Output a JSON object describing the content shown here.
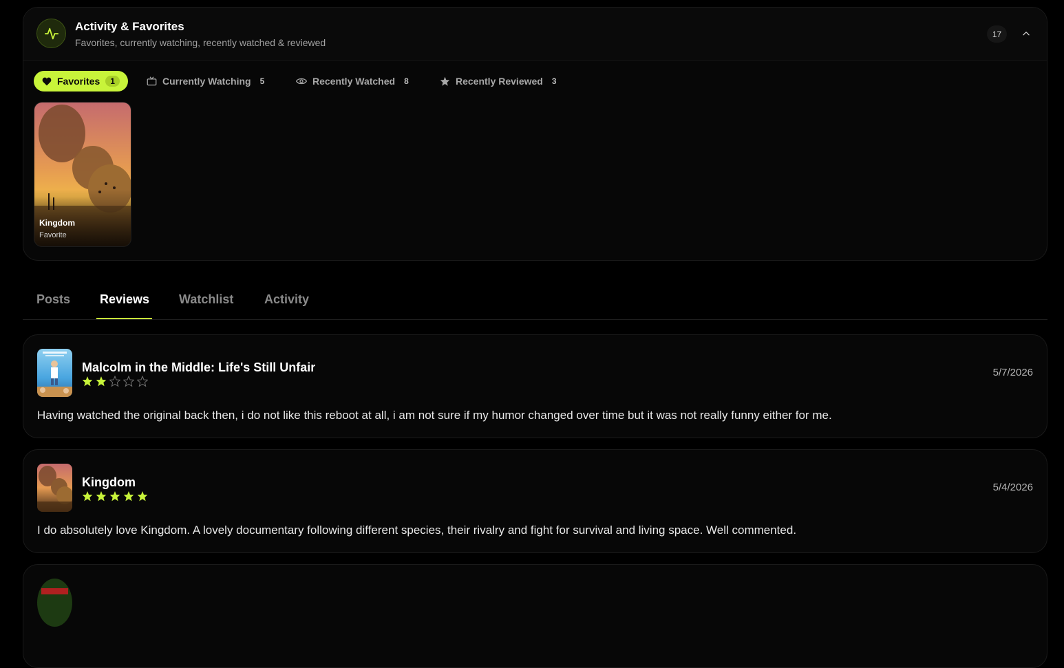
{
  "activity": {
    "title": "Activity & Favorites",
    "subtitle": "Favorites, currently watching, recently watched & reviewed",
    "total_count": "17",
    "accent_color": "#c8f43a",
    "chips": [
      {
        "label": "Favorites",
        "count": "1",
        "icon": "heart-icon",
        "active": true
      },
      {
        "label": "Currently Watching",
        "count": "5",
        "icon": "tv-icon",
        "active": false
      },
      {
        "label": "Recently Watched",
        "count": "8",
        "icon": "eye-icon",
        "active": false
      },
      {
        "label": "Recently Reviewed",
        "count": "3",
        "icon": "star-icon",
        "active": false
      }
    ],
    "favorites": [
      {
        "title": "Kingdom",
        "label": "Favorite",
        "poster_text": "KINGDOM"
      }
    ]
  },
  "tabs": {
    "items": [
      "Posts",
      "Reviews",
      "Watchlist",
      "Activity"
    ],
    "active": "Reviews"
  },
  "reviews": [
    {
      "title": "Malcolm in the Middle: Life's Still Unfair",
      "rating": 2,
      "max_rating": 5,
      "date": "5/7/2026",
      "text": "Having watched the original back then, i do not like this reboot at all, i am not sure if my humor changed over time but it was not really funny either for me."
    },
    {
      "title": "Kingdom",
      "rating": 5,
      "max_rating": 5,
      "date": "5/4/2026",
      "text": "I do absolutely love Kingdom. A lovely documentary following different species, their rivalry and fight for survival and living space. Well commented."
    }
  ]
}
